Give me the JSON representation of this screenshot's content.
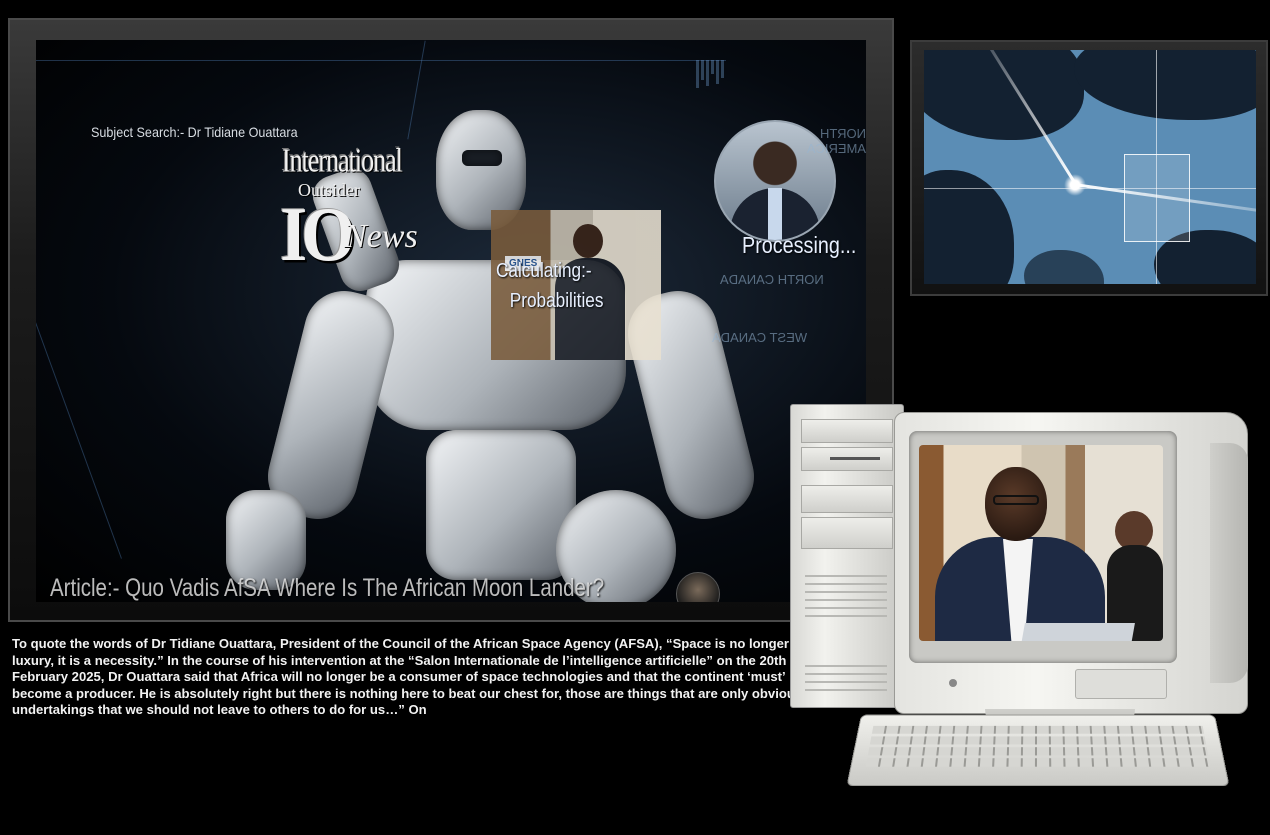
{
  "big_screen": {
    "subject_search": "Subject Search:- Dr Tidiane Ouattara",
    "logo": {
      "line1": "International",
      "line2": "Outsider",
      "line3": "IO",
      "line4": "News"
    },
    "inset_badge": "GNES",
    "calculating_line1": "Calculating:-",
    "calculating_line2": "Probabilities",
    "processing": "Processing...",
    "hud_label_1": "NORTH CANADA",
    "hud_label_2": "WEST CANADA",
    "hud_label_3": "NORTH AMERICA",
    "article_title": "Article:- Quo Vadis AfSA Where Is The African Moon Lander?"
  },
  "body_text": "To quote the words of Dr Tidiane Ouattara, President of the Council of the African Space Agency (AFSA), “Space is no longer a luxury, it is a necessity.” In the course of his intervention at the “Salon Internationale de l’intelligence artificielle” on the 20th February 2025, Dr Ouattara said that Africa will no longer be a consumer of space technologies and that the continent ‘must’ become a producer. He is absolutely right but there is nothing here to beat our chest for, those are things that are only obvious undertakings that we should not leave to others to do for us…” On",
  "colors": {
    "background": "#000000",
    "text": "#f2f2f2",
    "map_sea": "#5b8db5",
    "map_land": "#132131"
  }
}
